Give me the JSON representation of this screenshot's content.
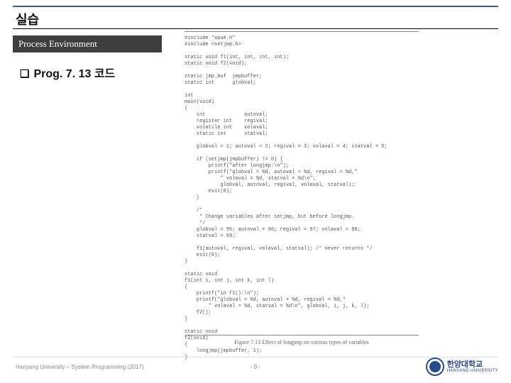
{
  "title": "실습",
  "subtitle": "Process Environment",
  "bullet1": "Prog. 7. 13 코드",
  "code": "#include \"apue.h\"\n#include <setjmp.h>\n\nstatic void f1(int, int, int, int);\nstatic void f2(void);\n\nstatic jmp_buf  jmpbuffer;\nstatic int      globval;\n\nint\nmain(void)\n{\n    int             autoval;\n    register int    regival;\n    volatile int    volaval;\n    static int      statval;\n\n    globval = 1; autoval = 2; regival = 3; volaval = 4; statval = 5;\n\n    if (setjmp(jmpbuffer) != 0) {\n        printf(\"after longjmp:\\n\");\n        printf(\"globval = %d, autoval = %d, regival = %d,\"\n            \" volaval = %d, statval = %d\\n\",\n            globval, autoval, regival, volaval, statval);\n        exit(0);\n    }\n\n    /*\n     * Change variables after setjmp, but before longjmp.\n     */\n    globval = 95; autoval = 96; regival = 97; volaval = 98;\n    statval = 99;\n\n    f1(autoval, regival, volaval, statval); /* never returns */\n    exit(0);\n}\n\nstatic void\nf1(int i, int j, int k, int l)\n{\n    printf(\"in f1():\\n\");\n    printf(\"globval = %d, autoval = %d, regival = %d,\"\n        \" volaval = %d, statval = %d\\n\", globval, i, j, k, l);\n    f2();\n}\n\nstatic void\nf2(void)\n{\n    longjmp(jmpbuffer, 1);\n}",
  "figure_caption": "Figure 7.13  Effect of longjmp on various types of variables",
  "footer": {
    "left": "Hanyang University – System Programming  (2017)",
    "center": "- 9 -",
    "logo_ko": "한양대학교",
    "logo_en": "HANYANG UNIVERSITY"
  }
}
